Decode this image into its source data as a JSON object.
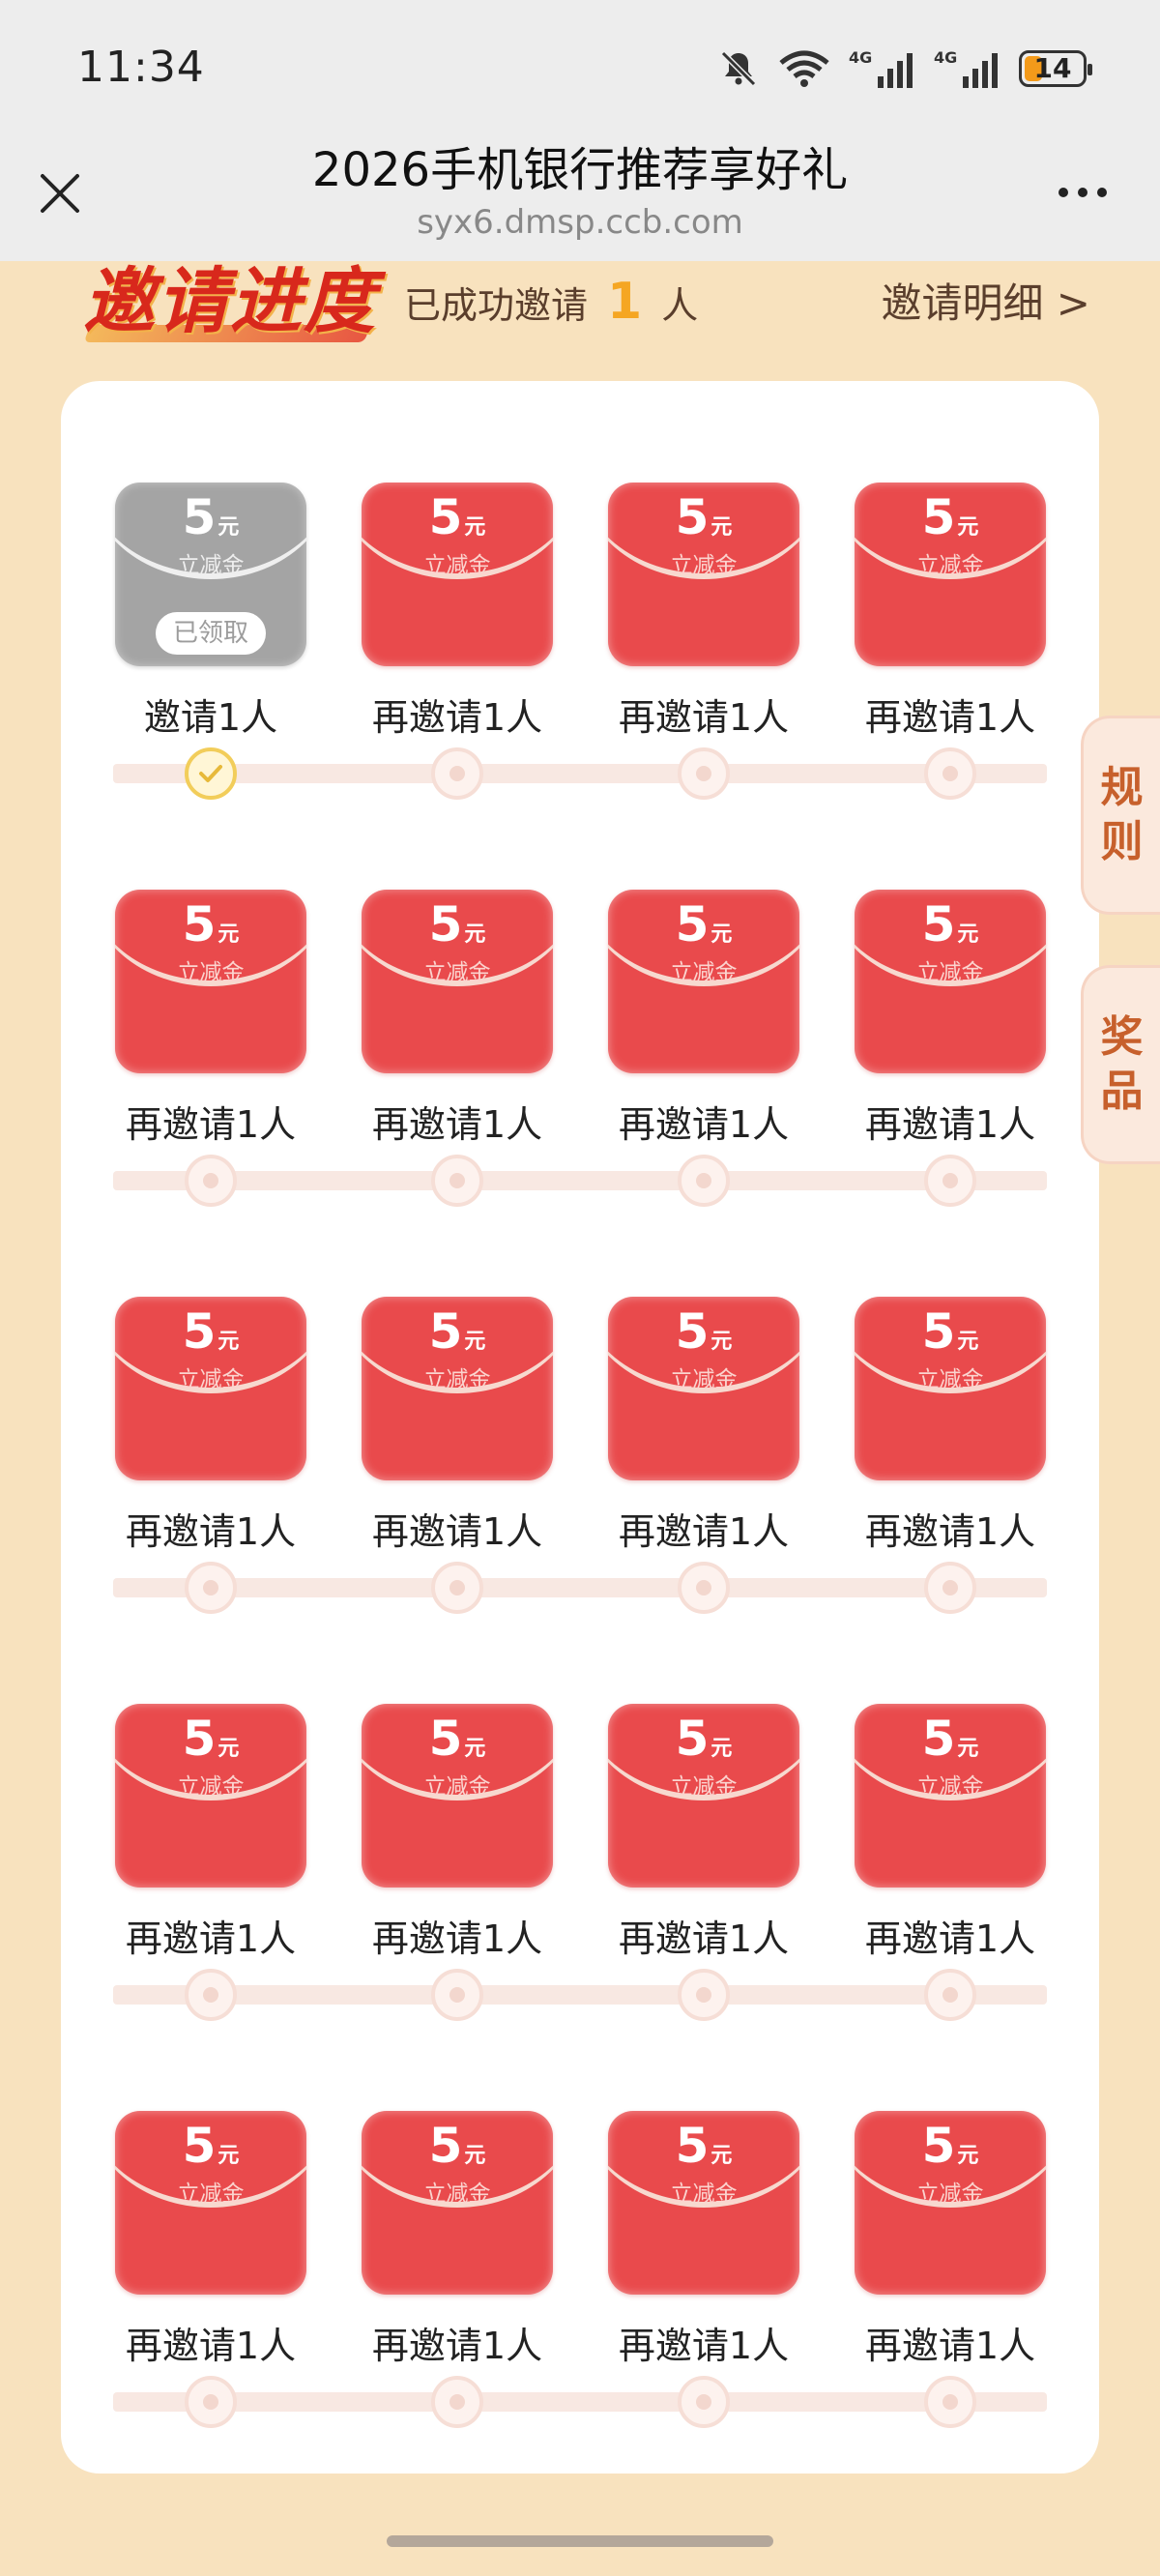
{
  "status_bar": {
    "time": "11:34",
    "network_1": "4G",
    "network_2": "4G",
    "battery": "14",
    "icons": [
      "mute-bell-icon",
      "wifi-icon",
      "signal-4g-icon",
      "signal-4g-icon",
      "battery-icon"
    ]
  },
  "nav": {
    "title": "2026手机银行推荐享好礼",
    "subtitle": "syx6.dmsp.ccb.com"
  },
  "header": {
    "section_title": "邀请进度",
    "invite_prefix": "已成功邀请",
    "invite_count": "1",
    "invite_suffix": "人",
    "detail_link": "邀请明细 >"
  },
  "rewards": {
    "amount": "5",
    "unit": "元",
    "sublabel": "立减金",
    "claimed_label": "已领取",
    "first_label": "邀请1人",
    "next_label": "再邀请1人",
    "rows": 5,
    "cols": 4,
    "claimed_count": 1
  },
  "side_tabs": {
    "rules": [
      "规",
      "则"
    ],
    "prizes": [
      "奖",
      "品"
    ]
  },
  "colors": {
    "page_bg": "#f8e2be",
    "envelope_red": "#e94a4c",
    "envelope_claimed": "#a4a4a4",
    "count_accent": "#f5a623",
    "done_marker": "#f2cd5a"
  }
}
